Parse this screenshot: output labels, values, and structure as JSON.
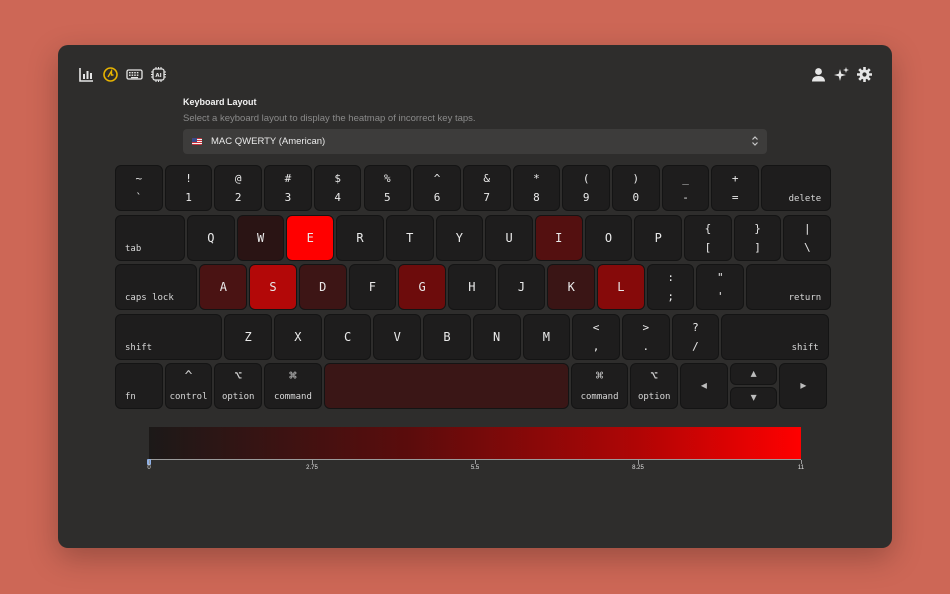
{
  "toolbar": {
    "left_icons": [
      "chart-icon",
      "speed-icon",
      "keyboard-icon",
      "ai-chip-icon"
    ],
    "right_icons": [
      "user-icon",
      "sparkles-icon",
      "gear-icon"
    ],
    "accent_color": "#e8b400"
  },
  "layout": {
    "title": "Keyboard Layout",
    "subtitle": "Select a keyboard layout to display the heatmap of incorrect key taps.",
    "selected": "MAC QWERTY (American)"
  },
  "keyboard": {
    "row1": [
      {
        "top": "~",
        "bottom": "`"
      },
      {
        "top": "!",
        "bottom": "1"
      },
      {
        "top": "@",
        "bottom": "2"
      },
      {
        "top": "#",
        "bottom": "3"
      },
      {
        "top": "$",
        "bottom": "4"
      },
      {
        "top": "%",
        "bottom": "5"
      },
      {
        "top": "^",
        "bottom": "6"
      },
      {
        "top": "&",
        "bottom": "7"
      },
      {
        "top": "*",
        "bottom": "8"
      },
      {
        "top": "(",
        "bottom": "9"
      },
      {
        "top": ")",
        "bottom": "0"
      },
      {
        "top": "_",
        "bottom": "-"
      },
      {
        "top": "+",
        "bottom": "="
      },
      {
        "label": "delete"
      }
    ],
    "row2": [
      {
        "label": "tab"
      },
      {
        "char": "Q"
      },
      {
        "char": "W"
      },
      {
        "char": "E"
      },
      {
        "char": "R"
      },
      {
        "char": "T"
      },
      {
        "char": "Y"
      },
      {
        "char": "U"
      },
      {
        "char": "I"
      },
      {
        "char": "O"
      },
      {
        "char": "P"
      },
      {
        "top": "{",
        "bottom": "["
      },
      {
        "top": "}",
        "bottom": "]"
      },
      {
        "top": "|",
        "bottom": "\\"
      }
    ],
    "row3": [
      {
        "label": "caps lock"
      },
      {
        "char": "A"
      },
      {
        "char": "S"
      },
      {
        "char": "D"
      },
      {
        "char": "F"
      },
      {
        "char": "G"
      },
      {
        "char": "H"
      },
      {
        "char": "J"
      },
      {
        "char": "K"
      },
      {
        "char": "L"
      },
      {
        "top": ":",
        "bottom": ";"
      },
      {
        "top": "\"",
        "bottom": "'"
      },
      {
        "label": "return"
      }
    ],
    "row4": [
      {
        "label": "shift"
      },
      {
        "char": "Z"
      },
      {
        "char": "X"
      },
      {
        "char": "C"
      },
      {
        "char": "V"
      },
      {
        "char": "B"
      },
      {
        "char": "N"
      },
      {
        "char": "M"
      },
      {
        "top": "<",
        "bottom": ","
      },
      {
        "top": ">",
        "bottom": "."
      },
      {
        "top": "?",
        "bottom": "/"
      },
      {
        "label": "shift"
      }
    ],
    "row5": [
      {
        "label": "fn"
      },
      {
        "label": "control",
        "sym": "^"
      },
      {
        "label": "option",
        "sym": "⌥"
      },
      {
        "label": "command",
        "sym": "⌘"
      },
      {
        "label": ""
      },
      {
        "label": "command",
        "sym": "⌘"
      },
      {
        "label": "option",
        "sym": "⌥"
      },
      {
        "arrow": "◀"
      },
      {
        "arrow": "▲"
      },
      {
        "arrow": "▼"
      },
      {
        "arrow": "▶"
      }
    ],
    "heat": {
      "W": "#2a1414",
      "E": "#ff0000",
      "I": "#541010",
      "A": "#4a1313",
      "S": "#b30808",
      "D": "#3d1515",
      "G": "#6d0c0c",
      "K": "#3a1515",
      "L": "#860a0a",
      "space": "#3a1616"
    }
  },
  "legend": {
    "min": 0,
    "max": 11,
    "ticks": [
      "0",
      "2.75",
      "5.5",
      "8.25",
      "11"
    ]
  }
}
